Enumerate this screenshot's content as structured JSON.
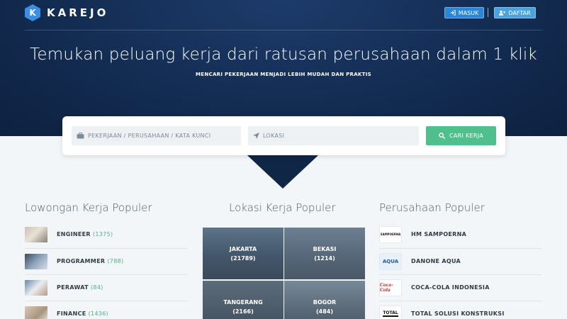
{
  "brand": {
    "name": "KAREJO",
    "logo_letter": "K"
  },
  "nav": {
    "login_label": "MASUK",
    "register_label": "DAFTAR"
  },
  "hero": {
    "title": "Temukan peluang kerja dari ratusan perusahaan dalam 1 klik",
    "subtitle": "MENCARI PEKERJAAN MENJADI LEBIH MUDAH DAN PRAKTIS"
  },
  "search": {
    "job_placeholder": "PEKERJAAN / PERUSAHAAN / KATA KUNCI",
    "location_placeholder": "LOKASI",
    "button_label": "CARI KERJA"
  },
  "jobs": {
    "title": "Lowongan Kerja Populer",
    "items": [
      {
        "label": "ENGINEER",
        "count": "(1375)"
      },
      {
        "label": "PROGRAMMER",
        "count": "(788)"
      },
      {
        "label": "PERAWAT",
        "count": "(84)"
      },
      {
        "label": "FINANCE",
        "count": "(1436)"
      }
    ]
  },
  "locations": {
    "title": "Lokasi Kerja Populer",
    "items": [
      {
        "city": "JAKARTA",
        "count": "(21789)"
      },
      {
        "city": "BEKASI",
        "count": "(1214)"
      },
      {
        "city": "TANGERANG",
        "count": "(2166)"
      },
      {
        "city": "BOGOR",
        "count": "(484)"
      }
    ]
  },
  "companies": {
    "title": "Perusahaan Populer",
    "items": [
      {
        "name": "HM SAMPOERNA",
        "logo_text": "SAMPOERNA"
      },
      {
        "name": "DANONE AQUA",
        "logo_text": "AQUA"
      },
      {
        "name": "COCA-COLA INDONESIA",
        "logo_text": "Coca-Cola"
      },
      {
        "name": "TOTAL SOLUSI KONSTRUKSI",
        "logo_text": "TOTAL"
      }
    ]
  },
  "colors": {
    "hero": "#132c52",
    "accent": "#4fbf8d",
    "primary": "#2a86d8",
    "count": "#4fae80"
  },
  "icons": [
    "briefcase-icon",
    "location-arrow-icon",
    "search-icon",
    "login-icon",
    "user-plus-icon"
  ]
}
